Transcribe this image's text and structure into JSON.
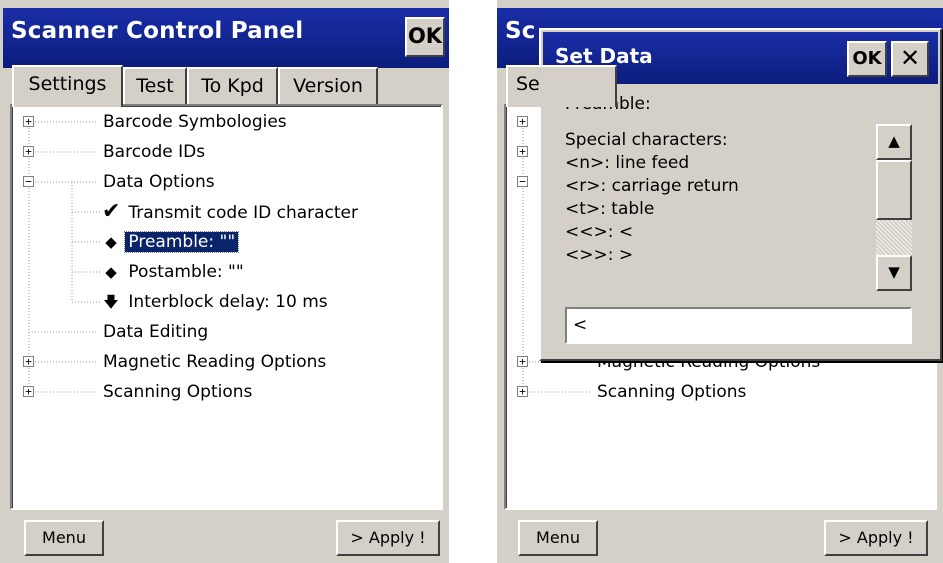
{
  "left": {
    "title": "Scanner Control Panel",
    "ok_label": "OK",
    "tabs": [
      "Settings",
      "Test",
      "To Kpd",
      "Version"
    ],
    "tree": [
      {
        "label": "Barcode Symbologies",
        "expander": "+"
      },
      {
        "label": "Barcode IDs",
        "expander": "+"
      },
      {
        "label": "Data Options",
        "expander": "−"
      },
      {
        "label": "Transmit code ID character",
        "icon": "✔"
      },
      {
        "label": "Preamble: \"\"",
        "icon": "◆",
        "selected": true
      },
      {
        "label": "Postamble: \"\"",
        "icon": "◆"
      },
      {
        "label": "Interblock delay: 10 ms",
        "icon": "🡇"
      },
      {
        "label": "Data Editing"
      },
      {
        "label": "Magnetic Reading Options",
        "expander": "+"
      },
      {
        "label": "Scanning Options",
        "expander": "+"
      }
    ],
    "menu_label": "Menu",
    "apply_label": "> Apply !"
  },
  "right": {
    "title_partial": "Sc",
    "tab_partial": "Se",
    "tree_visible": [
      {
        "label": "Magnetic Reading Options",
        "expander": "+"
      },
      {
        "label": "Scanning Options",
        "expander": "+"
      }
    ],
    "menu_label": "Menu",
    "apply_label": "> Apply !",
    "dialog": {
      "title": "Set Data",
      "ok_label": "OK",
      "close_label": "✕",
      "field_label": "Preamble:",
      "special_title": "Special characters:",
      "special_lines": [
        "<n>: line feed",
        "<r>: carriage return",
        "<t>: table",
        "<<>: <",
        "<>>: >"
      ],
      "input_value": "<",
      "scroll_up": "▲",
      "scroll_down": "▼"
    }
  },
  "icons": {
    "expander": "expand-collapse-box-icon",
    "check": "check-icon",
    "diamond": "diamond-icon",
    "arrow": "down-arrow-icon"
  },
  "colors": {
    "titlebar": "#0f1f8a",
    "panel": "#d4d0c8",
    "selection": "#0a246a"
  }
}
